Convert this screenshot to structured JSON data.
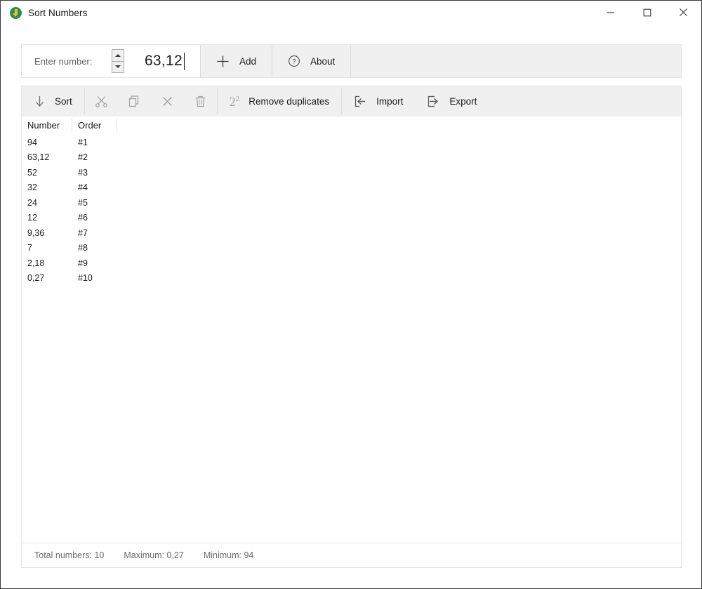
{
  "window": {
    "title": "Sort Numbers",
    "app_icon": "green-down-arrow-icon",
    "controls": {
      "minimize": "minimize-icon",
      "maximize": "maximize-icon",
      "close": "close-icon"
    }
  },
  "entry_bar": {
    "label": "Enter number:",
    "value": "63,12",
    "placeholder": "",
    "spinner_up": "spinner-up-icon",
    "spinner_down": "spinner-down-icon",
    "buttons": [
      {
        "label": "Add",
        "icon": "plus-icon"
      },
      {
        "label": "About",
        "icon": "question-circle-icon"
      }
    ]
  },
  "toolbar": {
    "items": [
      {
        "label": "Sort",
        "icon": "arrow-down-icon",
        "enabled": true
      },
      {
        "label": "",
        "icon": "cut-scissors-icon",
        "enabled": false
      },
      {
        "label": "",
        "icon": "copy-icon",
        "enabled": false
      },
      {
        "label": "",
        "icon": "delete-x-icon",
        "enabled": false
      },
      {
        "label": "",
        "icon": "trash-icon",
        "enabled": false
      },
      {
        "label": "Remove duplicates",
        "icon": "two-squared-icon",
        "enabled": true
      },
      {
        "label": "Import",
        "icon": "import-arrow-icon",
        "enabled": true
      },
      {
        "label": "Export",
        "icon": "export-arrow-icon",
        "enabled": true
      }
    ]
  },
  "list": {
    "columns": [
      "Number",
      "Order"
    ],
    "rows": [
      {
        "number": "94",
        "order": "#1"
      },
      {
        "number": "63,12",
        "order": "#2"
      },
      {
        "number": "52",
        "order": "#3"
      },
      {
        "number": "32",
        "order": "#4"
      },
      {
        "number": "24",
        "order": "#5"
      },
      {
        "number": "12",
        "order": "#6"
      },
      {
        "number": "9,36",
        "order": "#7"
      },
      {
        "number": "7",
        "order": "#8"
      },
      {
        "number": "2,18",
        "order": "#9"
      },
      {
        "number": "0,27",
        "order": "#10"
      }
    ]
  },
  "status_bar": {
    "total": "Total numbers: 10",
    "maximum": "Maximum: 0,27",
    "minimum": "Minimum: 94"
  },
  "colors": {
    "window_bg": "#ffffff",
    "chrome_bg": "#f0f0f0",
    "border": "#e4e4e4",
    "text": "#1a1a1a",
    "muted_text": "#6b6b6b",
    "disabled_icon": "#a0a0a0",
    "app_icon_green": "#2e8b57",
    "app_icon_yellow": "#f0c020"
  }
}
